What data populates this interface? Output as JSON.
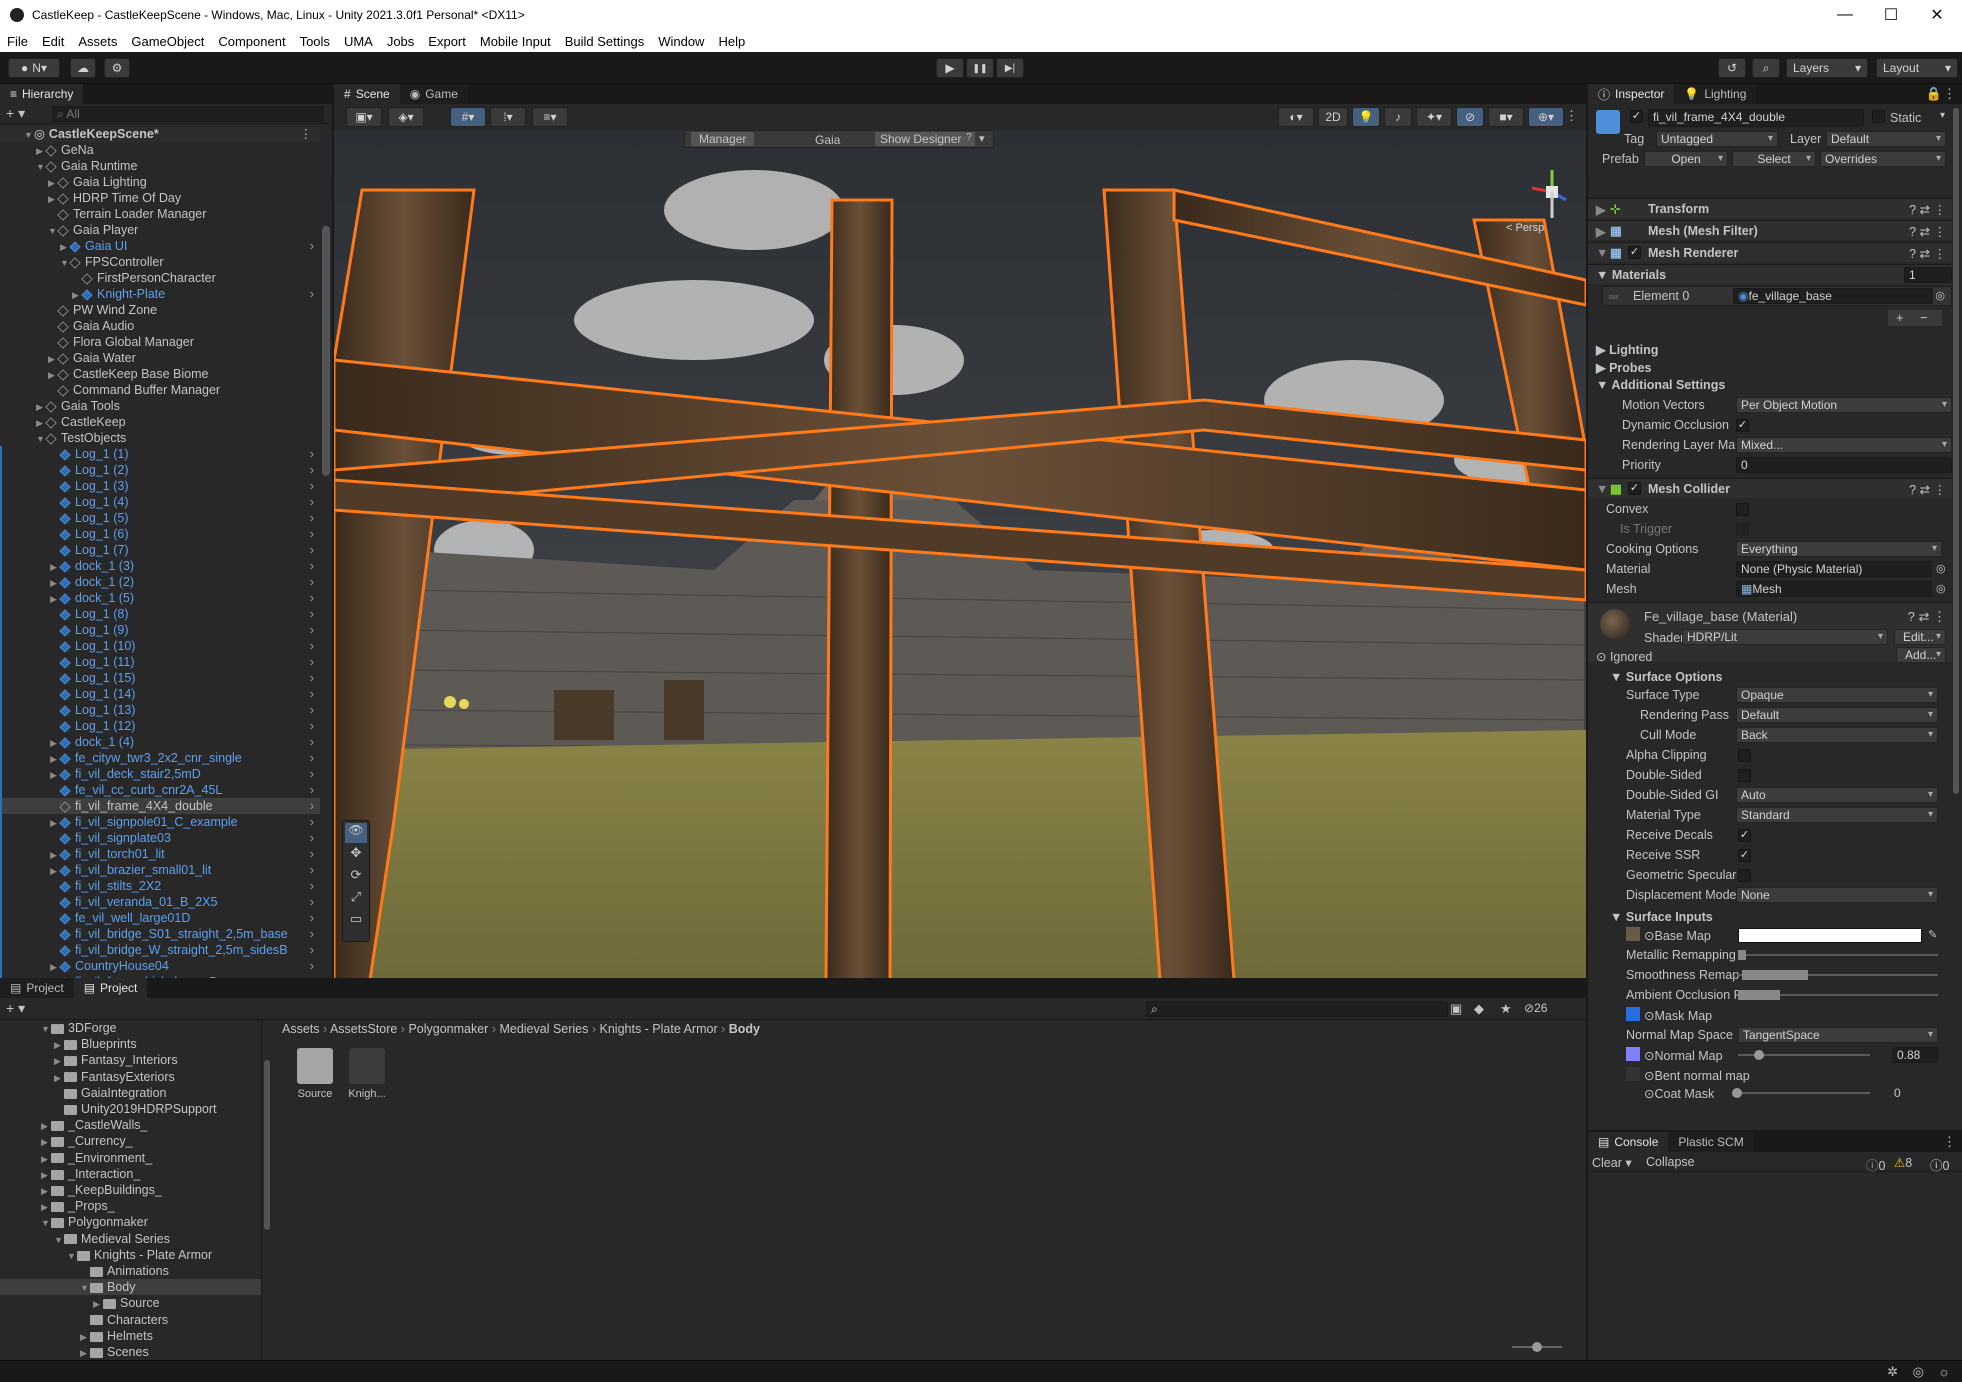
{
  "window": {
    "title": "CastleKeep - CastleKeepScene - Windows, Mac, Linux - Unity 2021.3.0f1 Personal* <DX11>",
    "minimize": "—",
    "maximize": "☐",
    "close": "✕"
  },
  "menu": [
    "File",
    "Edit",
    "Assets",
    "GameObject",
    "Component",
    "Tools",
    "UMA",
    "Jobs",
    "Export",
    "Mobile Input",
    "Build Settings",
    "Window",
    "Help"
  ],
  "toolbar": {
    "account": "N",
    "play": "▶",
    "pause": "❚❚",
    "step": "▶|",
    "layers": "Layers",
    "layout": "Layout"
  },
  "hierarchy": {
    "tab": "Hierarchy",
    "search_placeholder": "All",
    "scene": "CastleKeepScene*",
    "rows": [
      {
        "d": 1,
        "label": "GeNa",
        "blue": false,
        "exp": "▶"
      },
      {
        "d": 1,
        "label": "Gaia Runtime",
        "blue": false,
        "exp": "▼"
      },
      {
        "d": 2,
        "label": "Gaia Lighting",
        "blue": false,
        "exp": "▶"
      },
      {
        "d": 2,
        "label": "HDRP Time Of Day",
        "blue": false,
        "exp": "▶"
      },
      {
        "d": 2,
        "label": "Terrain Loader Manager",
        "blue": false,
        "exp": ""
      },
      {
        "d": 2,
        "label": "Gaia Player",
        "blue": false,
        "exp": "▼"
      },
      {
        "d": 3,
        "label": "Gaia UI",
        "blue": true,
        "exp": "▶"
      },
      {
        "d": 3,
        "label": "FPSController",
        "blue": false,
        "exp": "▼"
      },
      {
        "d": 4,
        "label": "FirstPersonCharacter",
        "blue": false,
        "exp": ""
      },
      {
        "d": 4,
        "label": "Knight-Plate",
        "blue": true,
        "exp": "▶"
      },
      {
        "d": 2,
        "label": "PW Wind Zone",
        "blue": false,
        "exp": ""
      },
      {
        "d": 2,
        "label": "Gaia Audio",
        "blue": false,
        "exp": ""
      },
      {
        "d": 2,
        "label": "Flora Global Manager",
        "blue": false,
        "exp": ""
      },
      {
        "d": 2,
        "label": "Gaia Water",
        "blue": false,
        "exp": "▶"
      },
      {
        "d": 2,
        "label": "CastleKeep Base Biome",
        "blue": false,
        "exp": "▶"
      },
      {
        "d": 2,
        "label": "Command Buffer Manager",
        "blue": false,
        "exp": ""
      },
      {
        "d": 1,
        "label": "Gaia Tools",
        "blue": false,
        "exp": "▶"
      },
      {
        "d": 1,
        "label": "CastleKeep",
        "blue": false,
        "exp": "▶"
      },
      {
        "d": 1,
        "label": "TestObjects",
        "blue": false,
        "exp": "▼"
      },
      {
        "d": 2,
        "label": "Log_1 (1)",
        "blue": true,
        "exp": ""
      },
      {
        "d": 2,
        "label": "Log_1 (2)",
        "blue": true,
        "exp": ""
      },
      {
        "d": 2,
        "label": "Log_1 (3)",
        "blue": true,
        "exp": ""
      },
      {
        "d": 2,
        "label": "Log_1 (4)",
        "blue": true,
        "exp": ""
      },
      {
        "d": 2,
        "label": "Log_1 (5)",
        "blue": true,
        "exp": ""
      },
      {
        "d": 2,
        "label": "Log_1 (6)",
        "blue": true,
        "exp": ""
      },
      {
        "d": 2,
        "label": "Log_1 (7)",
        "blue": true,
        "exp": ""
      },
      {
        "d": 2,
        "label": "dock_1 (3)",
        "blue": true,
        "exp": "▶"
      },
      {
        "d": 2,
        "label": "dock_1 (2)",
        "blue": true,
        "exp": "▶"
      },
      {
        "d": 2,
        "label": "dock_1 (5)",
        "blue": true,
        "exp": "▶"
      },
      {
        "d": 2,
        "label": "Log_1 (8)",
        "blue": true,
        "exp": ""
      },
      {
        "d": 2,
        "label": "Log_1 (9)",
        "blue": true,
        "exp": ""
      },
      {
        "d": 2,
        "label": "Log_1 (10)",
        "blue": true,
        "exp": ""
      },
      {
        "d": 2,
        "label": "Log_1 (11)",
        "blue": true,
        "exp": ""
      },
      {
        "d": 2,
        "label": "Log_1 (15)",
        "blue": true,
        "exp": ""
      },
      {
        "d": 2,
        "label": "Log_1 (14)",
        "blue": true,
        "exp": ""
      },
      {
        "d": 2,
        "label": "Log_1 (13)",
        "blue": true,
        "exp": ""
      },
      {
        "d": 2,
        "label": "Log_1 (12)",
        "blue": true,
        "exp": ""
      },
      {
        "d": 2,
        "label": "dock_1 (4)",
        "blue": true,
        "exp": "▶"
      },
      {
        "d": 2,
        "label": "fe_cityw_twr3_2x2_cnr_single",
        "blue": true,
        "exp": "▶"
      },
      {
        "d": 2,
        "label": "fi_vil_deck_stair2,5mD",
        "blue": true,
        "exp": "▶"
      },
      {
        "d": 2,
        "label": "fe_vil_cc_curb_cnr2A_45L",
        "blue": true,
        "exp": ""
      },
      {
        "d": 2,
        "label": "fi_vil_frame_4X4_double",
        "blue": false,
        "exp": "",
        "sel": true
      },
      {
        "d": 2,
        "label": "fi_vil_signpole01_C_example",
        "blue": true,
        "exp": "▶"
      },
      {
        "d": 2,
        "label": "fi_vil_signplate03",
        "blue": true,
        "exp": ""
      },
      {
        "d": 2,
        "label": "fi_vil_torch01_lit",
        "blue": true,
        "exp": "▶"
      },
      {
        "d": 2,
        "label": "fi_vil_brazier_small01_lit",
        "blue": true,
        "exp": "▶"
      },
      {
        "d": 2,
        "label": "fi_vil_stilts_2X2",
        "blue": true,
        "exp": ""
      },
      {
        "d": 2,
        "label": "fi_vil_veranda_01_B_2X5",
        "blue": true,
        "exp": ""
      },
      {
        "d": 2,
        "label": "fe_vil_well_large01D",
        "blue": true,
        "exp": ""
      },
      {
        "d": 2,
        "label": "fi_vil_bridge_S01_straight_2,5m_base",
        "blue": true,
        "exp": ""
      },
      {
        "d": 2,
        "label": "fi_vil_bridge_W_straight_2,5m_sidesB",
        "blue": true,
        "exp": ""
      },
      {
        "d": 2,
        "label": "CountryHouse04",
        "blue": true,
        "exp": "▶"
      },
      {
        "d": 2,
        "label": "fi_vil_farm_chick_large_B",
        "blue": true,
        "exp": ""
      }
    ]
  },
  "scene": {
    "tab_scene": "Scene",
    "tab_game": "Game",
    "btn_2d": "2D",
    "gaia_manager": "Manager",
    "gaia_label": "Gaia",
    "gaia_designer": "Show Designer",
    "gaia_help": "?",
    "persp": "< Persp"
  },
  "project": {
    "tab1": "Project",
    "tab2": "Project",
    "search_placeholder": "",
    "count": "26",
    "breadcrumb": [
      "Assets",
      "AssetsStore",
      "Polygonmaker",
      "Medieval Series",
      "Knights - Plate Armor",
      "Body"
    ],
    "tree": [
      {
        "d": 1,
        "label": "3DForge",
        "exp": "▼"
      },
      {
        "d": 2,
        "label": "Blueprints",
        "exp": "▶"
      },
      {
        "d": 2,
        "label": "Fantasy_Interiors",
        "exp": "▶"
      },
      {
        "d": 2,
        "label": "FantasyExteriors",
        "exp": "▶"
      },
      {
        "d": 2,
        "label": "GaiaIntegration",
        "exp": ""
      },
      {
        "d": 2,
        "label": "Unity2019HDRPSupport",
        "exp": ""
      },
      {
        "d": 1,
        "label": "_CastleWalls_",
        "exp": "▶"
      },
      {
        "d": 1,
        "label": "_Currency_",
        "exp": "▶"
      },
      {
        "d": 1,
        "label": "_Environment_",
        "exp": "▶"
      },
      {
        "d": 1,
        "label": "_Interaction_",
        "exp": "▶"
      },
      {
        "d": 1,
        "label": "_KeepBuildings_",
        "exp": "▶"
      },
      {
        "d": 1,
        "label": "_Props_",
        "exp": "▶"
      },
      {
        "d": 1,
        "label": "Polygonmaker",
        "exp": "▼"
      },
      {
        "d": 2,
        "label": "Medieval Series",
        "exp": "▼"
      },
      {
        "d": 3,
        "label": "Knights - Plate Armor",
        "exp": "▼"
      },
      {
        "d": 4,
        "label": "Animations",
        "exp": ""
      },
      {
        "d": 4,
        "label": "Body",
        "exp": "▼",
        "sel": true
      },
      {
        "d": 5,
        "label": "Source",
        "exp": "▶"
      },
      {
        "d": 4,
        "label": "Characters",
        "exp": ""
      },
      {
        "d": 4,
        "label": "Helmets",
        "exp": "▶"
      },
      {
        "d": 4,
        "label": "Scenes",
        "exp": "▶"
      }
    ],
    "assets": [
      {
        "label": "Source"
      },
      {
        "label": "Knigh..."
      }
    ]
  },
  "inspector": {
    "tab": "Inspector",
    "tab2": "Lighting",
    "name": "fi_vil_frame_4X4_double",
    "static": "Static",
    "tag_label": "Tag",
    "tag": "Untagged",
    "layer_label": "Layer",
    "layer": "Default",
    "prefab_label": "Prefab",
    "open": "Open",
    "select": "Select",
    "overrides": "Overrides",
    "comp_transform": "Transform",
    "comp_meshfilter": "Mesh (Mesh Filter)",
    "comp_meshrenderer": "Mesh Renderer",
    "materials": "Materials",
    "materials_count": "1",
    "element0": "Element 0",
    "element0_value": "fe_village_base",
    "plus": "+",
    "minus": "−",
    "lighting": "Lighting",
    "probes": "Probes",
    "additional": "Additional Settings",
    "motion_vectors": "Motion Vectors",
    "motion_vectors_value": "Per Object Motion",
    "dynamic_occlusion": "Dynamic Occlusion",
    "rendering_layer": "Rendering Layer Ma",
    "rendering_layer_value": "Mixed...",
    "priority": "Priority",
    "priority_value": "0",
    "comp_meshcollider": "Mesh Collider",
    "convex": "Convex",
    "is_trigger": "Is Trigger",
    "cooking": "Cooking Options",
    "cooking_value": "Everything",
    "material": "Material",
    "material_value": "None (Physic Material)",
    "mesh": "Mesh",
    "mesh_value": "Mesh",
    "mat_name": "Fe_village_base (Material)",
    "shader_label": "Shader",
    "shader": "HDRP/Lit",
    "edit": "Edit...",
    "ignored": "Ignored",
    "add": "Add...",
    "surface_options": "Surface Options",
    "surface_type": "Surface Type",
    "surface_type_value": "Opaque",
    "rendering_pass": "Rendering Pass",
    "rendering_pass_value": "Default",
    "cull_mode": "Cull Mode",
    "cull_mode_value": "Back",
    "alpha_clipping": "Alpha Clipping",
    "double_sided": "Double-Sided",
    "double_sided_gi": "Double-Sided GI",
    "double_sided_gi_value": "Auto",
    "material_type": "Material Type",
    "material_type_value": "Standard",
    "receive_decals": "Receive Decals",
    "receive_ssr": "Receive SSR",
    "geometric_specular": "Geometric Specular",
    "displacement": "Displacement Mode",
    "displacement_value": "None",
    "surface_inputs": "Surface Inputs",
    "base_map": "Base Map",
    "metallic_remap": "Metallic Remapping",
    "smoothness_remap": "Smoothness Remap",
    "ao": "Ambient Occlusion R",
    "mask_map": "Mask Map",
    "normal_space": "Normal Map Space",
    "normal_space_value": "TangentSpace",
    "normal_map": "Normal Map",
    "normal_value": "0.88",
    "bent_normal": "Bent normal map",
    "coat_mask": "Coat Mask",
    "coat_value": "0"
  },
  "console": {
    "tab": "Console",
    "tab2": "Plastic SCM",
    "clear": "Clear",
    "collapse": "Collapse",
    "errors": "0",
    "warnings": "8",
    "infos": "0"
  },
  "colors": {
    "accent": "#58a1f5",
    "selection_orange": "#ff7a1a",
    "panel": "#282828",
    "header": "#191919"
  }
}
